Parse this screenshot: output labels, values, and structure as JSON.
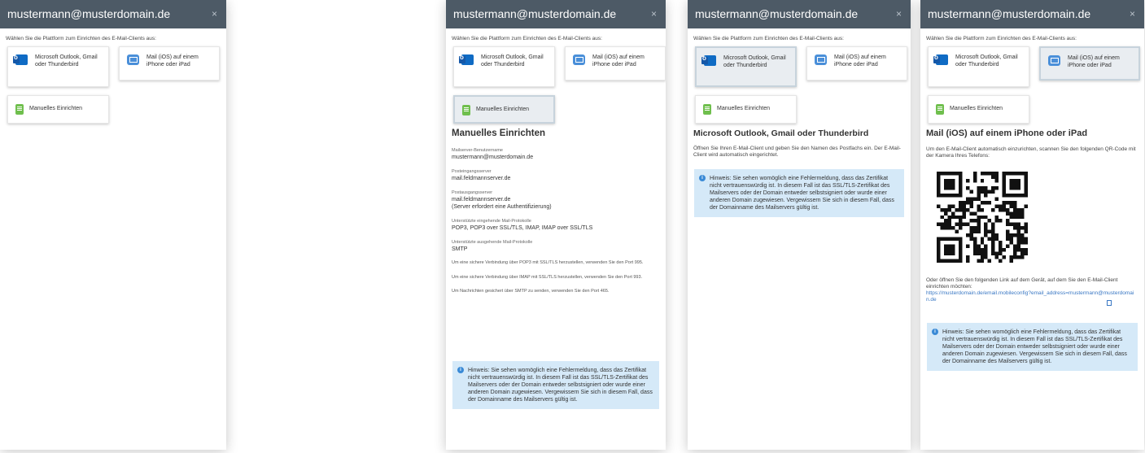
{
  "dialog": {
    "title": "mustermann@musterdomain.de",
    "close_glyph": "×",
    "intro": "Wählen Sie die Plattform zum Einrichten des E-Mail-Clients aus:"
  },
  "options": {
    "outlook": {
      "label": "Microsoft Outlook, Gmail oder Thunderbird",
      "icon": "outlook-icon"
    },
    "mail_ios": {
      "label": "Mail (iOS) auf einem iPhone oder iPad",
      "icon": "mail-app-icon"
    },
    "manual": {
      "label": "Manuelles Einrichten",
      "icon": "manual-setup-icon"
    }
  },
  "manual": {
    "title": "Manuelles Einrichten",
    "fields": [
      {
        "label": "Mailserver-Benutzername",
        "value": "mustermann@musterdomain.de"
      },
      {
        "label": "Posteingangsserver",
        "value": "mail.feldmannserver.de"
      },
      {
        "label": "Postausgangsserver",
        "value": "mail.feldmannserver.de",
        "extra": "(Server erfordert eine Authentifizierung)"
      },
      {
        "label": "Unterstützte eingehende Mail-Protokolle",
        "value": "POP3, POP3 over SSL/TLS, IMAP, IMAP over SSL/TLS"
      },
      {
        "label": "Unterstützte ausgehende Mail-Protokolle",
        "value": "SMTP"
      }
    ],
    "notes": [
      "Um eine sichere Verbindung über POP3 mit SSL/TLS herzustellen, verwenden Sie den Port 995.",
      "Um eine sichere Verbindung über IMAP mit SSL/TLS herzustellen, verwenden Sie den Port 993.",
      "Um Nachrichten gesichert über SMTP zu senden, verwenden Sie den Port 465."
    ]
  },
  "outlook_section": {
    "title": "Microsoft Outlook, Gmail oder Thunderbird",
    "text": "Öffnen Sie Ihren E-Mail-Client und geben Sie den Namen des Postfachs ein. Der E-Mail-Client wird automatisch eingerichtet."
  },
  "ios_section": {
    "title": "Mail (iOS) auf einem iPhone oder iPad",
    "text": "Um den E-Mail-Client automatisch einzurichten, scannen Sie den folgenden QR-Code mit der Kamera Ihres Telefons:",
    "alt_text": "Oder öffnen Sie den folgenden Link auf dem Gerät, auf dem Sie den E-Mail-Client einrichten möchten:",
    "link": "https://musterdomain.de/email.mobileconfig?email_address=mustermann@musterdomain.de",
    "copy_icon": "copy-icon"
  },
  "info_notice": "Hinweis: Sie sehen womöglich eine Fehlermeldung, dass das Zertifikat nicht vertrauenswürdig ist. In diesem Fall ist das SSL/TLS-Zertifikat des Mailservers oder der Domain entweder selbstsigniert oder wurde einer anderen Domain zugewiesen. Vergewissern Sie sich in diesem Fall, dass der Domainname des Mailservers gültig ist.",
  "colors": {
    "header": "#4d5a66",
    "info_bg": "#d5e9f8",
    "accent": "#3a8ad6"
  }
}
